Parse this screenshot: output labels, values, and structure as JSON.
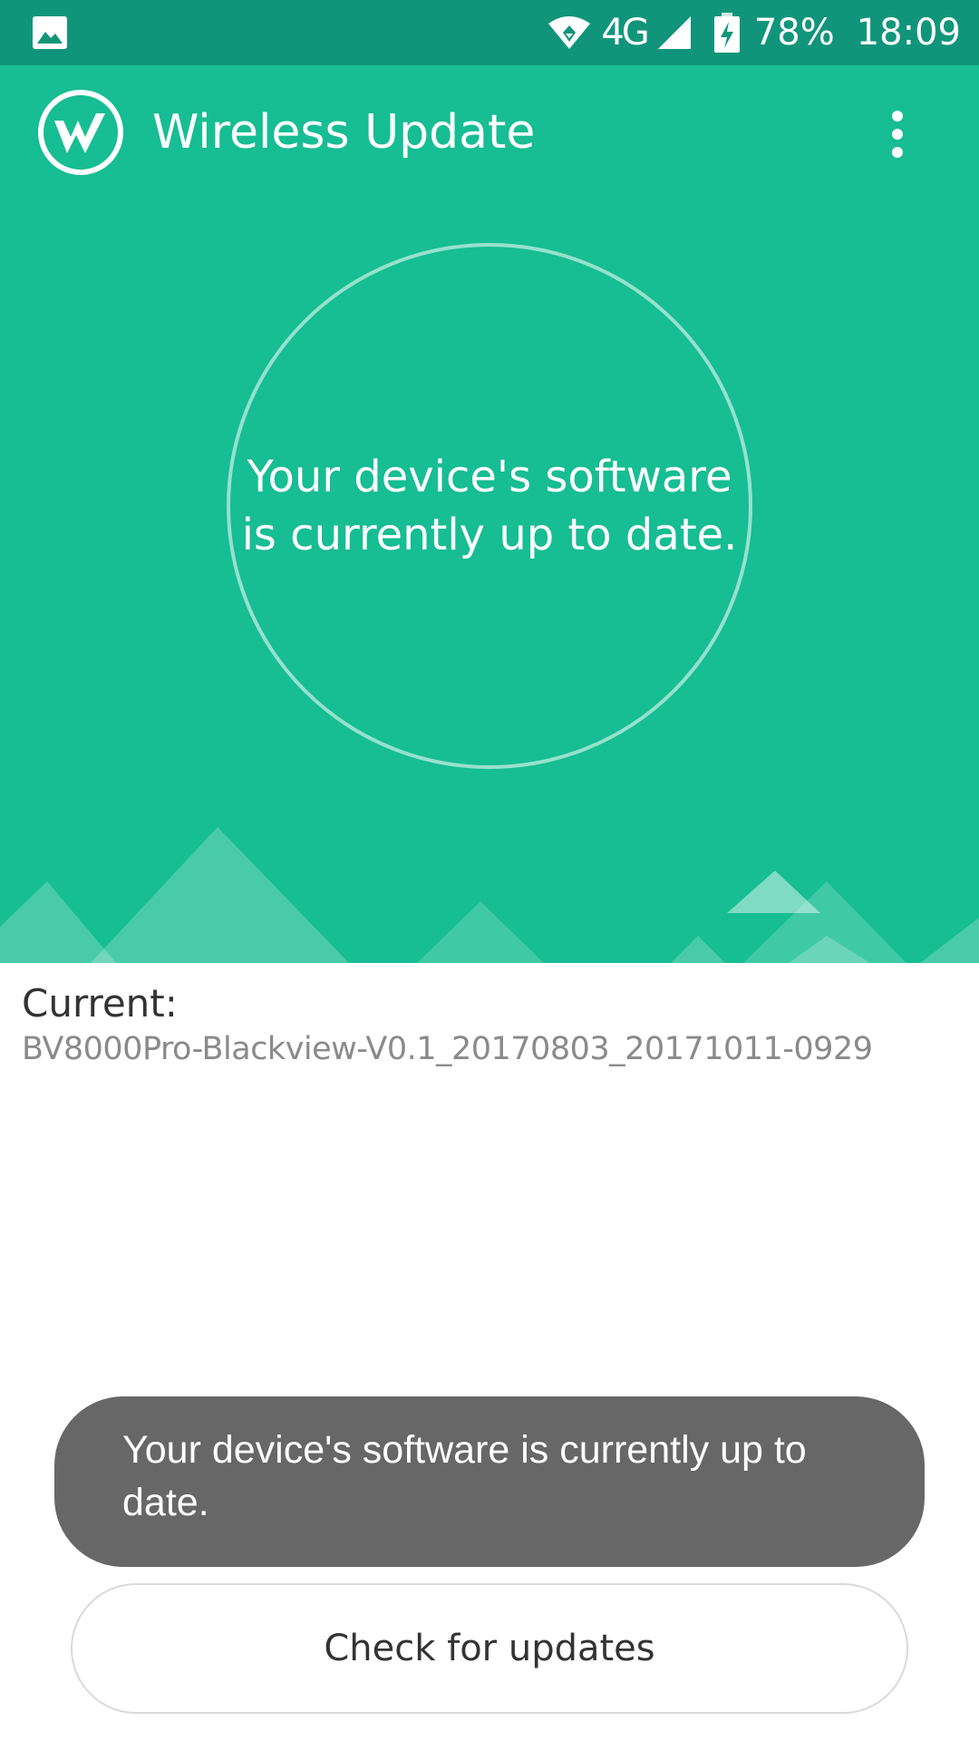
{
  "status_bar": {
    "gallery_icon": "image-icon",
    "network_type": "4G",
    "battery_percent": "78%",
    "time": "18:09"
  },
  "header": {
    "logo_icon": "wireless-update-logo",
    "title": "Wireless Update",
    "menu_icon": "more-vertical-icon"
  },
  "hero": {
    "status_message": "Your device's software is currently up to date."
  },
  "current": {
    "label": "Current:",
    "version": "BV8000Pro-Blackview-V0.1_20170803_20171011-0929"
  },
  "toast": {
    "message": "Your device's software is currently up to date."
  },
  "actions": {
    "check_label": "Check for updates"
  },
  "colors": {
    "status_bar": "#11957a",
    "primary": "#17bd93",
    "toast_bg": "#676767",
    "version_text": "#8a8a8a"
  }
}
